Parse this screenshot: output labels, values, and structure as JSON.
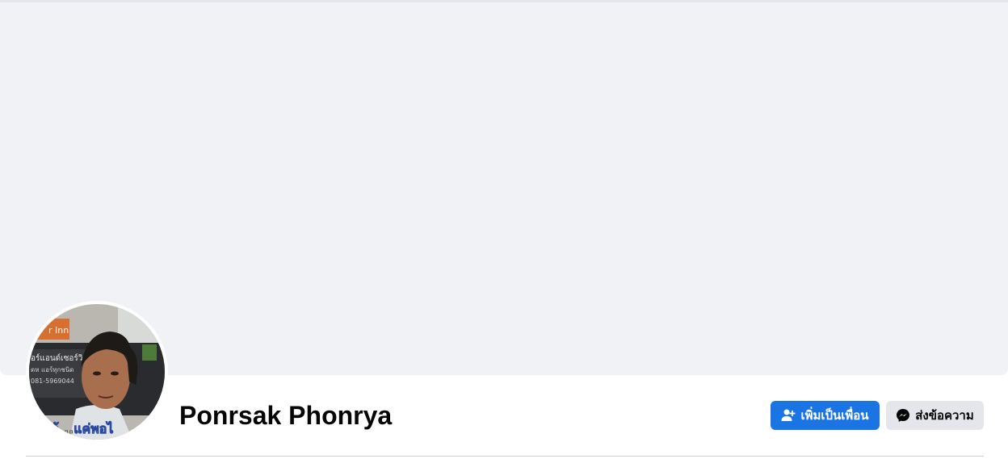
{
  "profile": {
    "name": "Ponrsak Phonrya",
    "avatar_overlay_text": "ว้...แค่พอไ"
  },
  "actions": {
    "add_friend_label": "เพิ่มเป็นเพื่อน",
    "add_friend_icon": "add-friend-icon",
    "message_label": "ส่งข้อความ",
    "message_icon": "messenger-icon"
  },
  "colors": {
    "primary": "#1b74e4",
    "secondary_button": "#e4e6eb",
    "cover_background": "#f0f2f5",
    "text": "#050505"
  }
}
